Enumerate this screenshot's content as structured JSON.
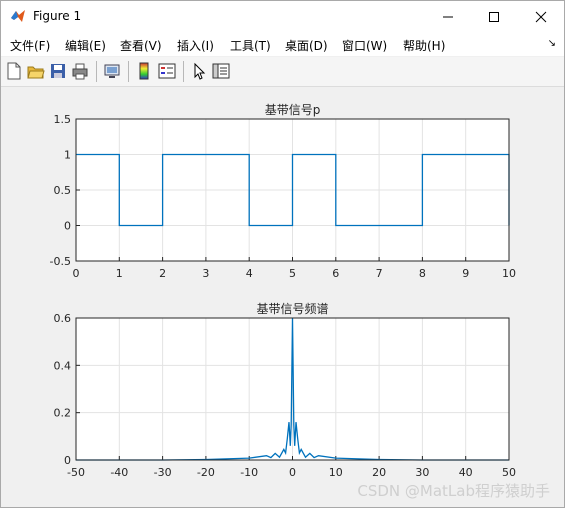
{
  "window": {
    "title": "Figure 1"
  },
  "menu": [
    "文件(F)",
    "编辑(E)",
    "查看(V)",
    "插入(I)",
    "工具(T)",
    "桌面(D)",
    "窗口(W)",
    "帮助(H)"
  ],
  "menu_overflow": "↘",
  "toolbar": {
    "buttons": [
      "new-figure",
      "open-file",
      "save",
      "print",
      "link-plot",
      "insert-colorbar",
      "insert-legend",
      "edit-plot",
      "property-inspector"
    ]
  },
  "watermark": "CSDN @MatLab程序猿助手",
  "chart_data": [
    {
      "type": "line",
      "title": "基带信号p",
      "xlabel": "",
      "ylabel": "",
      "xlim": [
        0,
        10
      ],
      "ylim": [
        -0.5,
        1.5
      ],
      "xticks": [
        "0",
        "1",
        "2",
        "3",
        "4",
        "5",
        "6",
        "7",
        "8",
        "9",
        "10"
      ],
      "yticks": [
        "-0.5",
        "0",
        "0.5",
        "1",
        "1.5"
      ],
      "grid": true,
      "series": [
        {
          "color": "#0072BD",
          "x": [
            0,
            1,
            1,
            2,
            2,
            4,
            4,
            5,
            5,
            6,
            6,
            8,
            8,
            10,
            10
          ],
          "y": [
            1,
            1,
            0,
            0,
            1,
            1,
            0,
            0,
            1,
            1,
            0,
            0,
            1,
            1,
            0
          ]
        }
      ]
    },
    {
      "type": "line",
      "title": "基带信号频谱",
      "xlabel": "",
      "ylabel": "",
      "xlim": [
        -50,
        50
      ],
      "ylim": [
        0,
        0.6
      ],
      "xticks": [
        "-50",
        "-40",
        "-30",
        "-20",
        "-10",
        "0",
        "10",
        "20",
        "30",
        "40",
        "50"
      ],
      "yticks": [
        "0",
        "0.2",
        "0.4",
        "0.6"
      ],
      "grid": true,
      "series": [
        {
          "color": "#0072BD",
          "x": [
            -50,
            -40,
            -30,
            -20,
            -10,
            -6,
            -5,
            -4,
            -3,
            -2,
            -1.6,
            -1.2,
            -0.8,
            -0.5,
            -0.3,
            0,
            0.3,
            0.5,
            0.8,
            1.2,
            1.6,
            2,
            3,
            4,
            5,
            6,
            10,
            20,
            30,
            40,
            50
          ],
          "y": [
            0,
            0,
            0,
            0.002,
            0.008,
            0.018,
            0.01,
            0.028,
            0.012,
            0.045,
            0.03,
            0.09,
            0.16,
            0.06,
            0.15,
            0.6,
            0.15,
            0.06,
            0.16,
            0.09,
            0.03,
            0.045,
            0.012,
            0.028,
            0.01,
            0.018,
            0.008,
            0.002,
            0,
            0,
            0
          ]
        }
      ]
    }
  ]
}
